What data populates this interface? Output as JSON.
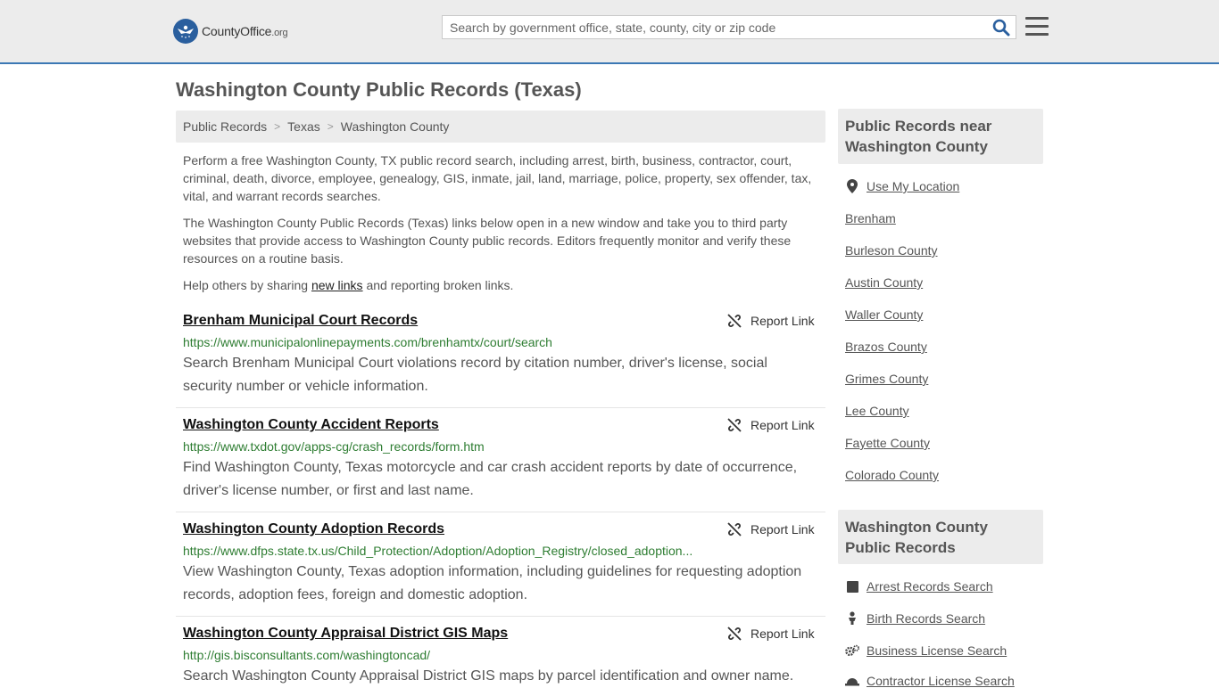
{
  "header": {
    "logo_name": "CountyOffice",
    "logo_suffix": ".org",
    "search_placeholder": "Search by government office, state, county, city or zip code"
  },
  "page_title": "Washington County Public Records (Texas)",
  "breadcrumb": [
    "Public Records",
    "Texas",
    "Washington County"
  ],
  "intro": {
    "p1": "Perform a free Washington County, TX public record search, including arrest, birth, business, contractor, court, criminal, death, divorce, employee, genealogy, GIS, inmate, jail, land, marriage, police, property, sex offender, tax, vital, and warrant records searches.",
    "p2": "The Washington County Public Records (Texas) links below open in a new window and take you to third party websites that provide access to Washington County public records. Editors frequently monitor and verify these resources on a routine basis.",
    "p3_before": "Help others by sharing ",
    "p3_link": "new links",
    "p3_after": " and reporting broken links."
  },
  "report_label": "Report Link",
  "records": [
    {
      "title": "Brenham Municipal Court Records",
      "url": "https://www.municipalonlinepayments.com/brenhamtx/court/search",
      "desc": "Search Brenham Municipal Court violations record by citation number, driver's license, social security number or vehicle information."
    },
    {
      "title": "Washington County Accident Reports",
      "url": "https://www.txdot.gov/apps-cg/crash_records/form.htm",
      "desc": "Find Washington County, Texas motorcycle and car crash accident reports by date of occurrence, driver's license number, or first and last name."
    },
    {
      "title": "Washington County Adoption Records",
      "url": "https://www.dfps.state.tx.us/Child_Protection/Adoption/Adoption_Registry/closed_adoption...",
      "desc": "View Washington County, Texas adoption information, including guidelines for requesting adoption records, adoption fees, foreign and domestic adoption."
    },
    {
      "title": "Washington County Appraisal District GIS Maps",
      "url": "http://gis.bisconsultants.com/washingtoncad/",
      "desc": "Search Washington County Appraisal District GIS maps by parcel identification and owner name."
    }
  ],
  "sidebar": {
    "near_title": "Public Records near Washington County",
    "use_location": "Use My Location",
    "near_links": [
      "Brenham",
      "Burleson County",
      "Austin County",
      "Waller County",
      "Brazos County",
      "Grimes County",
      "Lee County",
      "Fayette County",
      "Colorado County"
    ],
    "records_title": "Washington County Public Records",
    "record_links": [
      {
        "label": "Arrest Records Search",
        "icon": "square-icon"
      },
      {
        "label": "Birth Records Search",
        "icon": "baby-icon"
      },
      {
        "label": "Business License Search",
        "icon": "gears-icon"
      },
      {
        "label": "Contractor License Search",
        "icon": "hardhat-icon"
      }
    ]
  }
}
